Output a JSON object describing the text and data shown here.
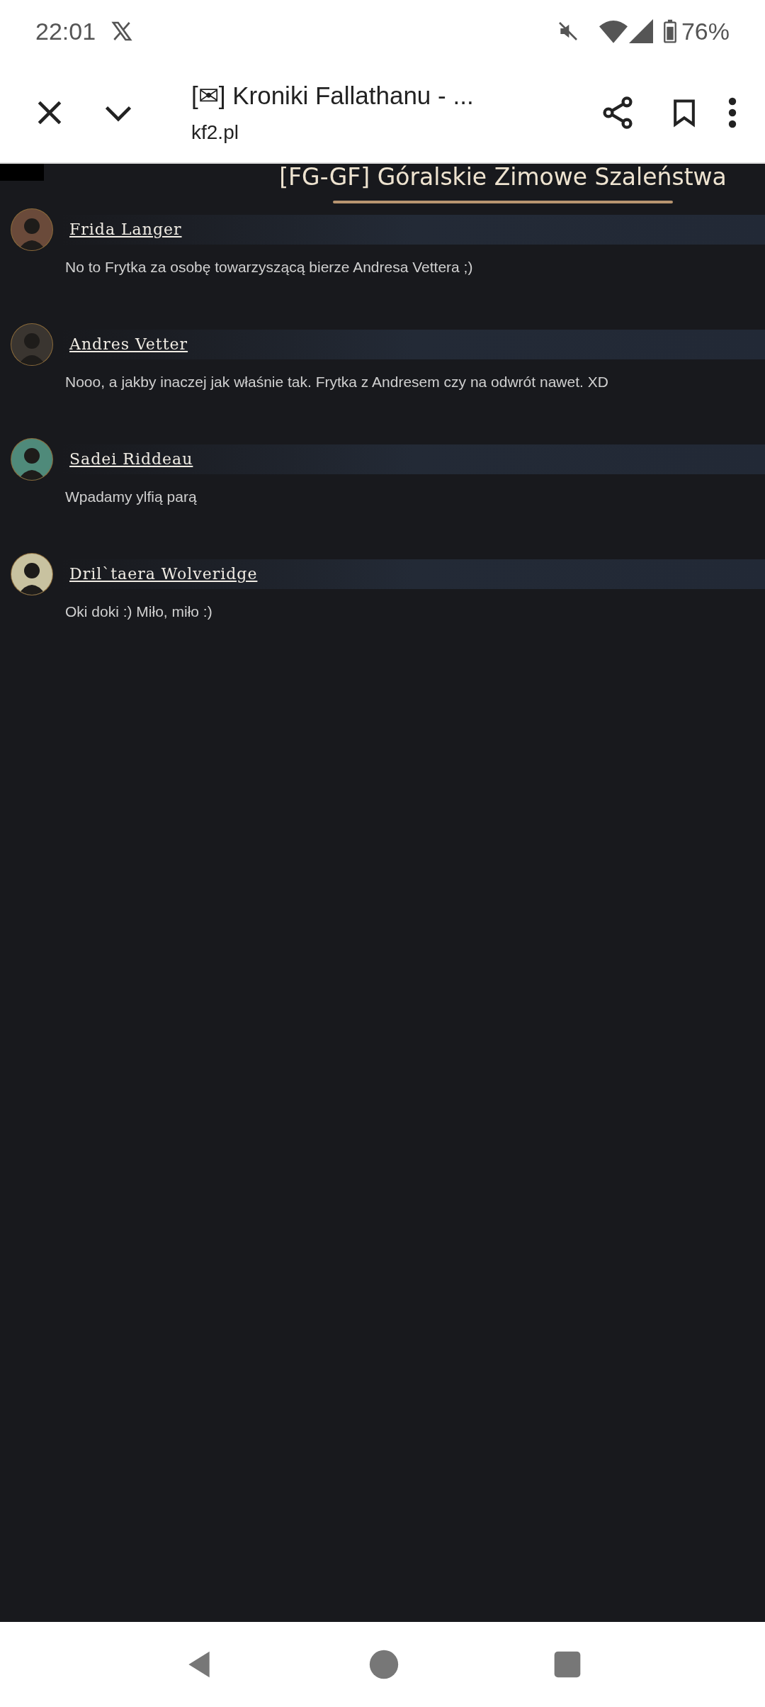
{
  "status_bar": {
    "time": "22:01",
    "battery": "76%"
  },
  "browser_bar": {
    "title": "[✉] Kroniki Fallathanu - ...",
    "url": "kf2.pl"
  },
  "thread": {
    "title": "[FG-GF] Góralskie Zimowe Szaleństwa",
    "posts": [
      {
        "author": "Frida Langer",
        "text": "No to Frytka za osobę towarzyszącą bierze Andresa Vettera ;)",
        "color": "#6a4a3a"
      },
      {
        "author": "Andres Vetter",
        "text": "Nooo, a jakby inaczej jak właśnie tak. Frytka z Andresem czy na odwrót nawet. XD",
        "color": "#3a3530"
      },
      {
        "author": "Sadei Riddeau",
        "text": "Wpadamy ylfią parą",
        "color": "#4f8a7a"
      },
      {
        "author": "Dril`taera Wolveridge",
        "text": "Oki doki :) Miło, miło :)",
        "color": "#c8c2a0"
      }
    ]
  }
}
